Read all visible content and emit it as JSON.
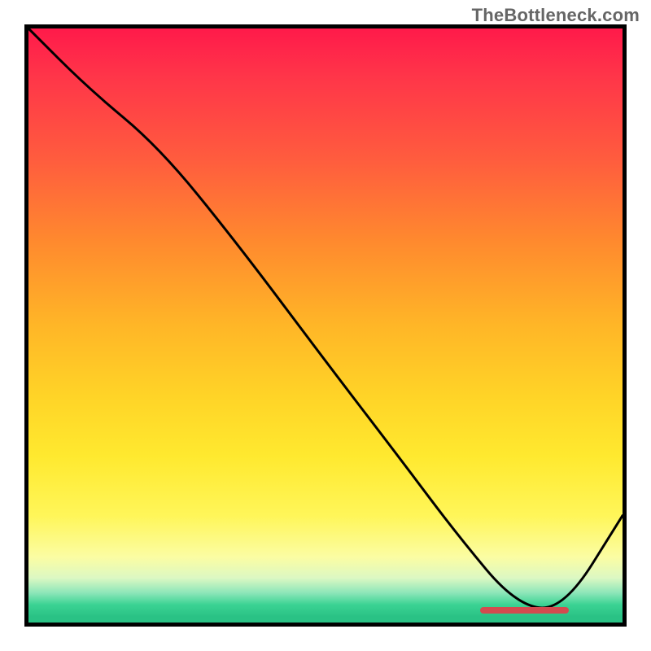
{
  "watermark": "TheBottleneck.com",
  "chart_data": {
    "type": "line",
    "title": "",
    "xlabel": "",
    "ylabel": "",
    "xlim": [
      0,
      100
    ],
    "ylim": [
      0,
      100
    ],
    "grid": false,
    "series": [
      {
        "name": "bottleneck-curve",
        "x": [
          0,
          10,
          22,
          35,
          50,
          63,
          72,
          82,
          90,
          100
        ],
        "y": [
          100,
          90,
          80,
          64,
          44,
          27,
          15,
          3,
          2,
          18
        ]
      }
    ],
    "optimal_zone": {
      "x_start": 76,
      "x_end": 91,
      "y": 2
    },
    "colors": {
      "curve": "#000000",
      "marker": "#d34b4f",
      "gradient_top": "#ff1a4a",
      "gradient_bottom": "#2ac285"
    }
  }
}
